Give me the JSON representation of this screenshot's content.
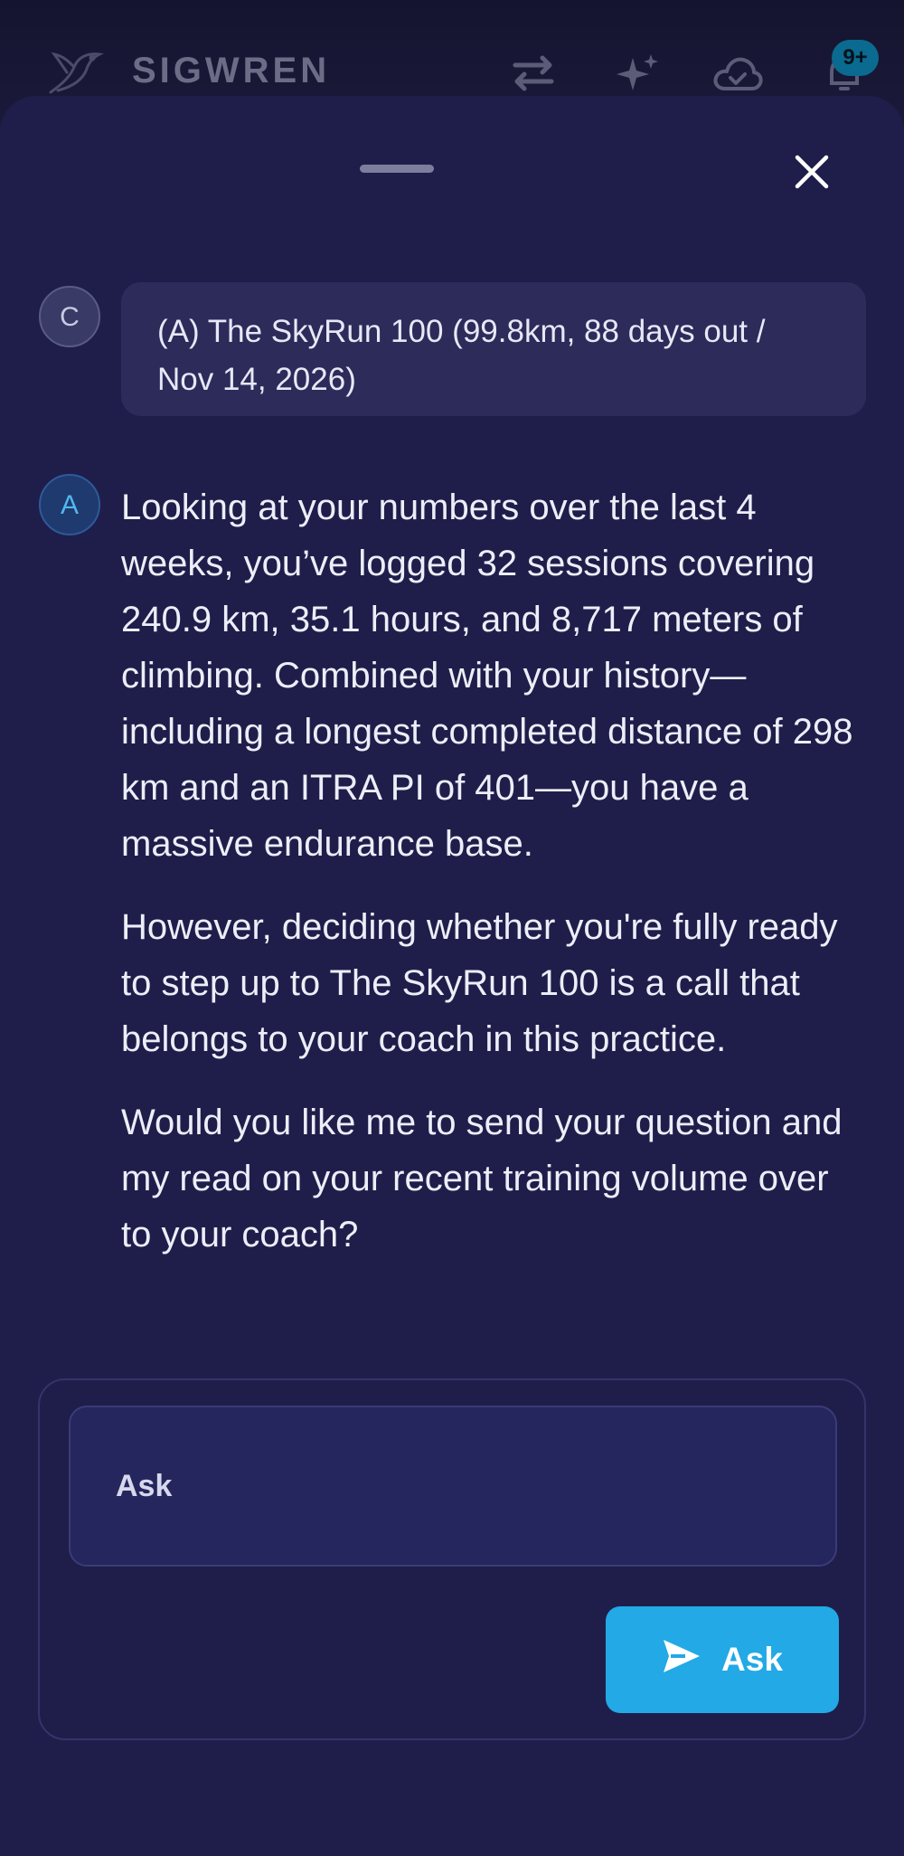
{
  "app": {
    "brand": "SIGWREN",
    "notification_count": "9+"
  },
  "icons": {
    "logo": "bird-logo-icon",
    "swap": "swap-arrows-icon",
    "sparkle": "sparkle-icon",
    "sync": "cloud-check-icon",
    "notifications": "bell-icon",
    "close": "close-icon",
    "send": "send-icon"
  },
  "conversation": {
    "user_avatar": "C",
    "user_message": "(A) The SkyRun 100 (99.8km, 88 days out / Nov 14, 2026)",
    "assistant_avatar": "A",
    "assistant_paragraphs": [
      "Looking at your numbers over the last 4 weeks, you’ve logged 32 sessions covering 240.9 km, 35.1 hours, and 8,717 meters of climbing. Combined with your history—including a longest completed distance of 298 km and an ITRA PI of 401—you have a massive endurance base.",
      "However, deciding whether you're fully ready to step up to The SkyRun 100 is a call that belongs to your coach in this practice.",
      "Would you like me to send your question and my read on your recent training volume over to your coach?"
    ]
  },
  "composer": {
    "placeholder": "Ask",
    "button_label": "Ask"
  },
  "colors": {
    "accent": "#22a9e6",
    "sheet": "#1f1e4a",
    "bubble": "#2c2b5a"
  }
}
